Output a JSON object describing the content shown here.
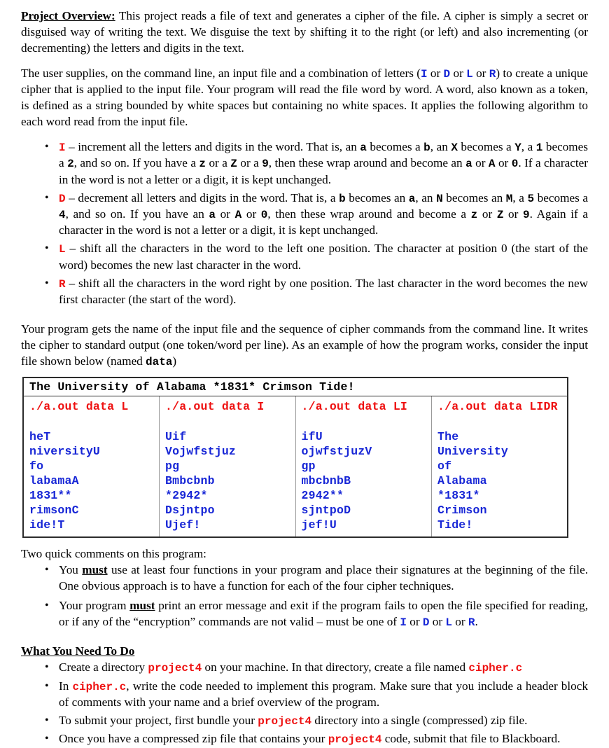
{
  "document": {
    "overview": {
      "heading": "Project Overview:",
      "body_1": "  This project reads a file of text and generates a cipher of the file.  A cipher is simply a secret or disguised way of writing the text.  We disguise the text by shifting it to the right (or left) and also incrementing (or decrementing) the letters and digits in the text."
    },
    "usage_paragraph": {
      "part_1": "The user supplies, on the command line, an input file and a combination of letters (",
      "code_i": "I",
      "sep_or_1": " or ",
      "code_d": "D",
      "sep_or_2": " or ",
      "code_l": "L",
      "sep_or_3": " or ",
      "code_r": "R",
      "part_2": ") to create a unique cipher that is applied to the input file.  Your program will read the file word by word.  A word, also known as a token, is defined as a string bounded by white spaces but containing no white spaces.  It applies the following algorithm to each word read from the input file."
    },
    "commands": [
      {
        "code": "I",
        "text_1": " – increment all the letters and digits in the word.  That is, an ",
        "t_a": "a",
        "text_2": " becomes a ",
        "t_b": "b",
        "text_3": ", an ",
        "t_c": "X",
        "text_4": " becomes a ",
        "t_d": "Y",
        "text_5": ", a ",
        "t_e": "1",
        "text_6": " becomes a ",
        "t_f": "2",
        "text_7": ", and so on.  If you have a ",
        "t_g": "z",
        "text_8": " or a ",
        "t_h": "Z",
        "text_9": " or a ",
        "t_i": "9",
        "text_10": ", then these wrap around and become an ",
        "t_j": "a",
        "text_11": " or ",
        "t_k": "A",
        "text_12": " or ",
        "t_l": "0",
        "text_13": ". If a character in the word is not a letter or a digit, it is kept unchanged."
      },
      {
        "code": "D",
        "text_1": " – decrement all letters and digits in the word.  That is, a ",
        "t_a": "b",
        "text_2": " becomes an ",
        "t_b": "a",
        "text_3": ", an ",
        "t_c": "N",
        "text_4": " becomes an ",
        "t_d": "M",
        "text_5": ", a ",
        "t_e": "5",
        "text_6": " becomes a ",
        "t_f": "4",
        "text_7": ", and so on.  If you have an ",
        "t_g": "a",
        "text_8": " or ",
        "t_h": "A",
        "text_9": " or ",
        "t_i": "0",
        "text_10": ", then these wrap around and become a ",
        "t_j": "z",
        "text_11": " or ",
        "t_k": "Z",
        "text_12": " or ",
        "t_l": "9",
        "text_13": ". Again if a character in the word is not a letter or a digit, it is kept unchanged."
      }
    ],
    "commands_simple": [
      {
        "code": "L",
        "text": " – shift all the characters in the word to the left one position.  The character at position 0 (the start of the word) becomes the new last character in the word."
      },
      {
        "code": "R",
        "text": " – shift all the characters in the word right by one position.  The last character in the word becomes the new first character (the start of the word)."
      }
    ],
    "example_paragraph": {
      "part_1": "Your program gets the name of the input file and the sequence of cipher commands from the command line.  It writes the cipher to standard output (one token/word per line).  As an example of how the program works, consider the input file shown below (named ",
      "file_name": "data",
      "part_2": ")"
    },
    "table": {
      "input_line": "The University of Alabama *1831* Crimson Tide!",
      "columns": [
        {
          "command": "./a.out data L",
          "tokens": [
            "heT",
            "niversityU",
            "fo",
            "labamaA",
            "1831**",
            "rimsonC",
            "ide!T"
          ]
        },
        {
          "command": "./a.out data I",
          "tokens": [
            "Uif",
            "Vojwfstjuz",
            "pg",
            "Bmbcbnb",
            "*2942*",
            "Dsjntpo",
            "Ujef!"
          ]
        },
        {
          "command": "./a.out data LI",
          "tokens": [
            "ifU",
            "ojwfstjuzV",
            "gp",
            "mbcbnbB",
            "2942**",
            "sjntpoD",
            "jef!U"
          ]
        },
        {
          "command": "./a.out data LIDR",
          "tokens": [
            "The",
            "University",
            "of",
            "Alabama",
            "*1831*",
            "Crimson",
            "Tide!"
          ]
        }
      ]
    },
    "comments": {
      "intro": "Two quick comments on this program:",
      "items": [
        {
          "part_1": "You ",
          "emph": "must",
          "part_2": " use at least four functions in your program and place their signatures at the beginning of the file.  One obvious approach is to have a function for each of the four cipher techniques."
        },
        {
          "part_1": "Your program ",
          "emph": "must",
          "part_2": " print an error message and exit if the program fails to open the file specified for reading, or if any of the “encryption” commands are not valid – must be one of ",
          "code_i": "I",
          "sep_1": " or ",
          "code_d": "D",
          "sep_2": " or ",
          "code_l": "L",
          "sep_3": " or ",
          "code_r": "R",
          "part_3": "."
        }
      ]
    },
    "todo": {
      "heading": "What You Need To Do",
      "items": [
        {
          "part_1": "Create a directory ",
          "code_1": "project4",
          "part_2": " on your machine.  In that directory, create a file named ",
          "code_2": "cipher.c",
          "part_3": ""
        },
        {
          "part_1": "In ",
          "code_1": "cipher.c",
          "part_2": ", write the code needed to implement this program.  Make sure that you include a header block of comments with your name and a brief overview of the program.",
          "code_2": "",
          "part_3": ""
        },
        {
          "part_1": "To submit your project, first bundle your ",
          "code_1": "project4",
          "part_2": " directory into a single (compressed) zip file.",
          "code_2": "",
          "part_3": ""
        },
        {
          "part_1": "Once you have a compressed zip file that contains your ",
          "code_1": "project4",
          "part_2": " code, submit that file to Blackboard.",
          "code_2": "",
          "part_3": ""
        }
      ]
    },
    "colors": {
      "code_blue": "#1726d6",
      "code_red": "#ee1111",
      "text_black": "#000000",
      "table_border": "#2b2b2b",
      "table_divider": "#9a9a9a"
    }
  }
}
